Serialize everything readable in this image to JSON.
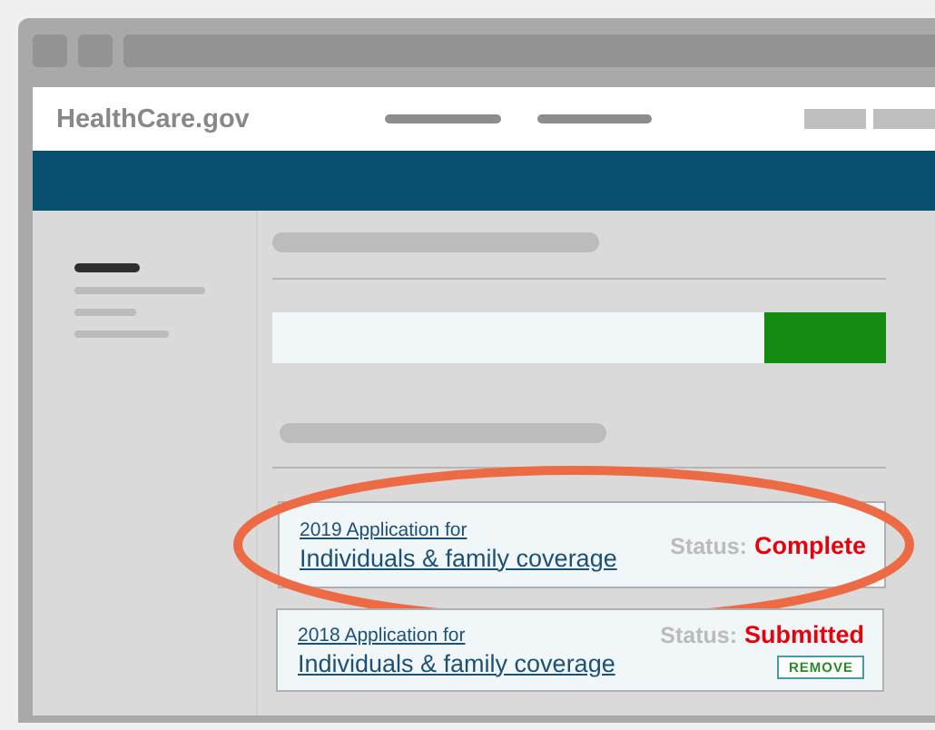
{
  "header": {
    "logo": "HealthCare.gov"
  },
  "applications": [
    {
      "year_label": "2019 Application for",
      "title": "Individuals & family coverage",
      "status_label": "Status:",
      "status": "Complete",
      "highlighted": true
    },
    {
      "year_label": "2018 Application for",
      "title": "Individuals & family coverage",
      "status_label": "Status:",
      "status": "Submitted",
      "highlighted": false,
      "actions": [
        "REMOVE"
      ]
    }
  ]
}
